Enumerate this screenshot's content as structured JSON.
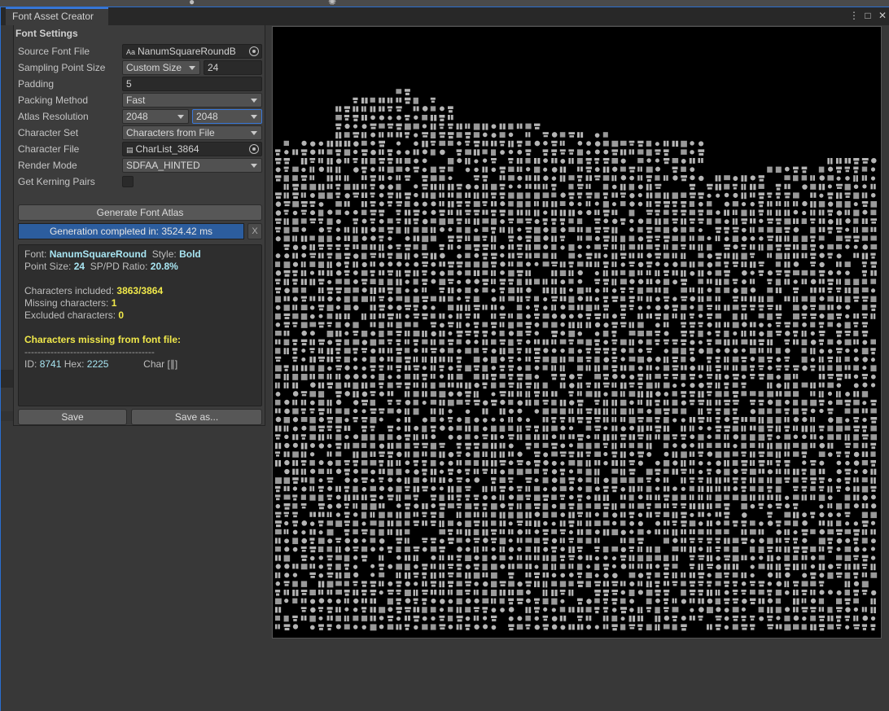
{
  "window": {
    "tab_title": "Font Asset Creator",
    "icons": [
      "kebab-menu-icon",
      "maximize-icon",
      "close-icon"
    ]
  },
  "settings": {
    "section_title": "Font Settings",
    "source_font_file": {
      "label": "Source Font File",
      "value": "NanumSquareRoundB",
      "icon": "font-file-icon"
    },
    "sampling_point_size": {
      "label": "Sampling Point Size",
      "mode": "Custom Size",
      "value": "24"
    },
    "padding": {
      "label": "Padding",
      "value": "5"
    },
    "packing_method": {
      "label": "Packing Method",
      "value": "Fast"
    },
    "atlas_resolution": {
      "label": "Atlas Resolution",
      "width": "2048",
      "height": "2048"
    },
    "character_set": {
      "label": "Character Set",
      "value": "Characters from File"
    },
    "character_file": {
      "label": "Character File",
      "value": "CharList_3864",
      "icon": "text-file-icon"
    },
    "render_mode": {
      "label": "Render Mode",
      "value": "SDFAA_HINTED"
    },
    "get_kerning_pairs": {
      "label": "Get Kerning Pairs",
      "checked": false
    }
  },
  "actions": {
    "generate_label": "Generate Font Atlas",
    "progress_text": "Generation completed in: 3524.42 ms",
    "progress": 1.0,
    "close_label": "X",
    "save_label": "Save",
    "save_as_label": "Save as..."
  },
  "report": {
    "font_label": "Font:",
    "font_name": "NanumSquareRound",
    "style_label": "Style:",
    "style_value": "Bold",
    "point_size_label": "Point Size:",
    "point_size_value": "24",
    "ratio_label": "SP/PD Ratio:",
    "ratio_value": "20.8%",
    "included_label": "Characters included:",
    "included_value": "3863/3864",
    "missing_label": "Missing characters:",
    "missing_value": "1",
    "excluded_label": "Excluded characters:",
    "excluded_value": "0",
    "missing_header": "Characters missing from font file:",
    "separator": "----------------------------------------",
    "missing_id_label": "ID:",
    "missing_id": "8741",
    "missing_hex_label": "Hex:",
    "missing_hex": "2225",
    "missing_char": "Char [∥]"
  },
  "atlas": {
    "background": "#000000",
    "glyph_color": "#b4b4b4"
  }
}
